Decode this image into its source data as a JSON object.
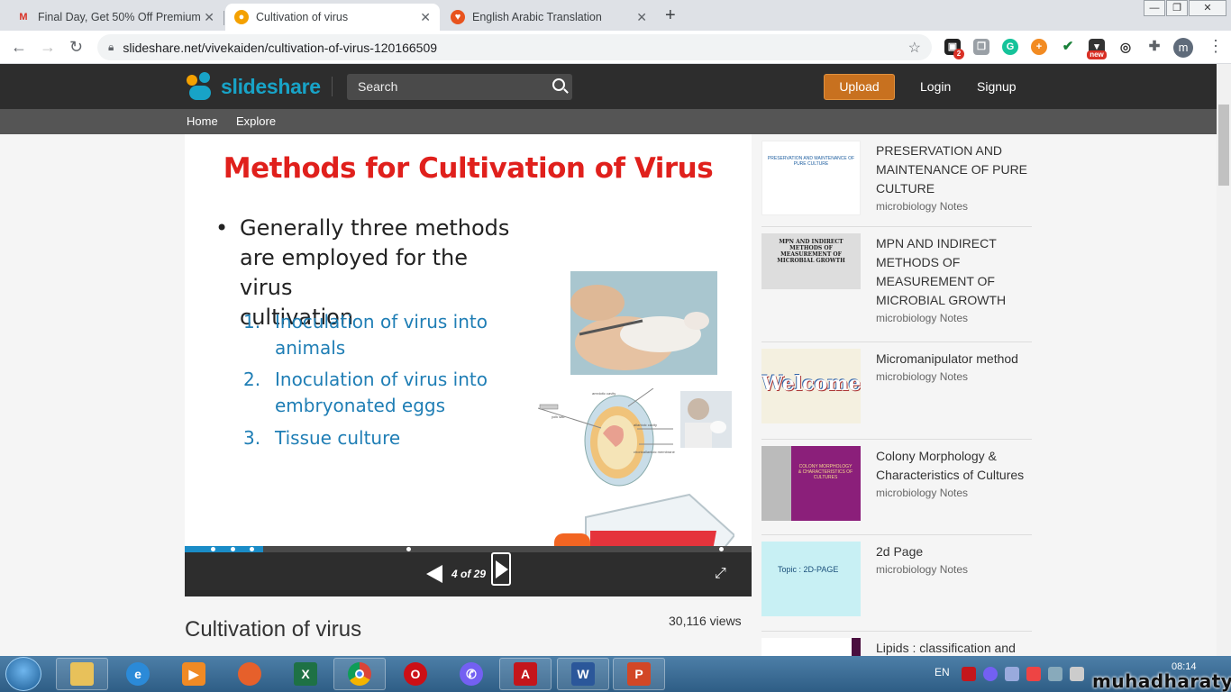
{
  "browser": {
    "tabs": [
      {
        "title": "Final Day, Get 50% Off Premium",
        "favicon": "gmail-icon"
      },
      {
        "title": "Cultivation of virus",
        "favicon": "slideshare-icon"
      },
      {
        "title": "English Arabic Translation",
        "favicon": "translate-icon"
      }
    ],
    "url": "slideshare.net/vivekaiden/cultivation-of-virus-120166509",
    "profile_initial": "m",
    "ext_badge_count": "2",
    "ext_new_badge": "new"
  },
  "site": {
    "logo": "slideshare",
    "search_placeholder": "Search",
    "upload": "Upload",
    "login": "Login",
    "signup": "Signup",
    "nav": [
      "Home",
      "Explore"
    ]
  },
  "slide": {
    "title": "Methods for Cultivation of Virus",
    "bullet": [
      "Generally three methods",
      "are employed for the virus",
      "cultivation"
    ],
    "methods": [
      {
        "num": "1.",
        "lines": [
          "Inoculation of virus into",
          "animals"
        ]
      },
      {
        "num": "2.",
        "lines": [
          "Inoculation of virus into",
          "embryonated eggs"
        ]
      },
      {
        "num": "3.",
        "lines": [
          "Tissue culture"
        ]
      }
    ],
    "egg_labels": [
      "amniotic cavity",
      "yolk sac",
      "allantoic cavity",
      "chorioallantoic membrane"
    ]
  },
  "player": {
    "page_label": "4 of 29",
    "current_page": 4,
    "total_pages": 29
  },
  "document": {
    "title": "Cultivation of virus",
    "views": "30,116 views"
  },
  "related": [
    {
      "title": "PRESERVATION AND MAINTENANCE OF PURE CULTURE",
      "sub": "microbiology Notes",
      "thumb_text": "PRESERVATION AND MAINTENANCE OF PURE CULTURE"
    },
    {
      "title": "MPN AND INDIRECT METHODS OF MEASUREMENT OF MICROBIAL GROWTH",
      "sub": "microbiology Notes",
      "thumb_text": "MPN AND INDIRECT METHODS OF MEASUREMENT OF MICROBIAL GROWTH"
    },
    {
      "title": "Micromanipulator method",
      "sub": "microbiology Notes",
      "thumb_text": "Welcome"
    },
    {
      "title": "Colony Morphology & Characteristics of Cultures",
      "sub": "microbiology Notes",
      "thumb_text": "COLONY MORPHOLOGY & CHARACTERISTICS OF CULTURES"
    },
    {
      "title": "2d Page",
      "sub": "microbiology Notes",
      "thumb_text": "Topic : 2D-PAGE"
    },
    {
      "title": "Lipids : classification and",
      "sub": "",
      "thumb_text": ""
    }
  ],
  "taskbar": {
    "apps": [
      "explorer",
      "internet-explorer",
      "media-player",
      "firefox",
      "excel",
      "chrome",
      "opera",
      "viber",
      "acrobat",
      "word",
      "powerpoint"
    ],
    "lang": "EN",
    "time": "08:14"
  },
  "watermark": "muhadharaty.com",
  "colors": {
    "accent": "#c8711f",
    "slide_title": "#e0201c",
    "method_text": "#1f7eb5",
    "header": "#2d2d2d"
  }
}
